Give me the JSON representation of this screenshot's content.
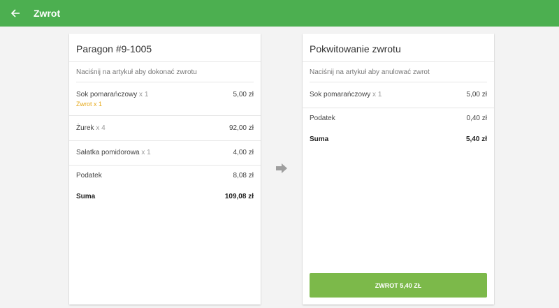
{
  "appbar": {
    "title": "Zwrot",
    "back_icon": "arrow-left-icon"
  },
  "receipt": {
    "title": "Paragon #9-1005",
    "hint": "Naciśnij na artykuł aby dokonać zwrotu",
    "items": [
      {
        "name": "Sok pomarańczowy",
        "qty": "x 1",
        "price": "5,00 zł",
        "returned": "Zwrot x 1"
      },
      {
        "name": "Żurek",
        "qty": "x 4",
        "price": "92,00 zł"
      },
      {
        "name": "Sałatka pomidorowa",
        "qty": "x 1",
        "price": "4,00 zł"
      }
    ],
    "tax_label": "Podatek",
    "tax_value": "8,08 zł",
    "total_label": "Suma",
    "total_value": "109,08 zł"
  },
  "refund": {
    "title": "Pokwitowanie zwrotu",
    "hint": "Naciśnij na artykuł aby anulować zwrot",
    "items": [
      {
        "name": "Sok pomarańczowy",
        "qty": "x 1",
        "price": "5,00 zł"
      }
    ],
    "tax_label": "Podatek",
    "tax_value": "0,40 zł",
    "total_label": "Suma",
    "total_value": "5,40 zł",
    "button_label": "ZWROT 5,40 ZŁ"
  },
  "transfer_icon": "arrow-right-icon",
  "colors": {
    "appbar": "#4caf50",
    "button": "#7cb94a",
    "returned": "#e6a817"
  }
}
